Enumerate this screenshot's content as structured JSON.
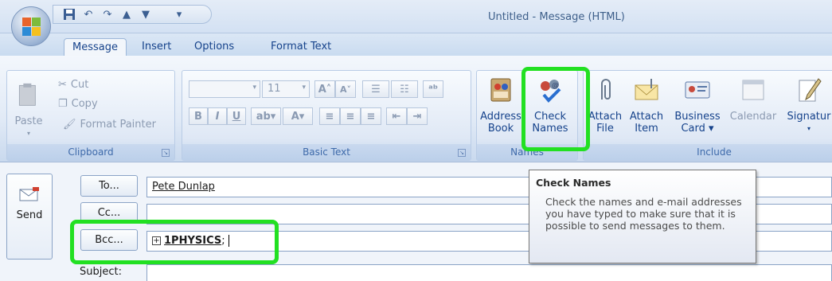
{
  "window": {
    "title": "Untitled - Message (HTML)"
  },
  "quick_access": {
    "icons": [
      "save-icon",
      "undo-icon",
      "redo-icon",
      "up-arrow-icon",
      "down-arrow-icon",
      "customize-icon"
    ]
  },
  "tabs": [
    {
      "label": "Message",
      "active": true
    },
    {
      "label": "Insert",
      "active": false
    },
    {
      "label": "Options",
      "active": false
    },
    {
      "label": "Format Text",
      "active": false
    }
  ],
  "ribbon": {
    "clipboard": {
      "label": "Clipboard",
      "paste": "Paste",
      "cut": "Cut",
      "copy": "Copy",
      "format_painter": "Format Painter"
    },
    "basic_text": {
      "label": "Basic Text",
      "font_size": "11"
    },
    "names": {
      "label": "Names",
      "address_book": [
        "Address",
        "Book"
      ],
      "check_names": [
        "Check",
        "Names"
      ]
    },
    "include": {
      "label": "Include",
      "attach_file": [
        "Attach",
        "File"
      ],
      "attach_item": [
        "Attach",
        "Item"
      ],
      "business_card": [
        "Business",
        "Card ▾"
      ],
      "calendar": "Calendar",
      "signature": "Signatur"
    }
  },
  "message": {
    "send_label": "Send",
    "to_label": "To...",
    "to_value": "Pete Dunlap",
    "cc_label": "Cc...",
    "bcc_label": "Bcc...",
    "bcc_value": "1PHYSICS",
    "bcc_separator": ";",
    "subject_label": "Subject:"
  },
  "tooltip": {
    "title": "Check Names",
    "body": "Check the names and e-mail addresses you have typed to make sure that it is possible to send messages to them."
  },
  "colors": {
    "highlight": "#22e022",
    "ribbon_text": "#15428b"
  }
}
